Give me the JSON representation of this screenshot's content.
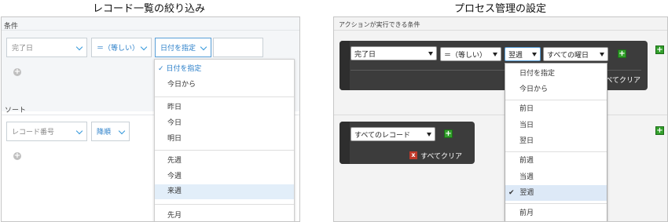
{
  "left": {
    "heading": "レコード一覧の絞り込み",
    "conditions_label": "条件",
    "field_select": "完了日",
    "operator_select": "＝（等しい）",
    "date_select": "日付を指定",
    "add_symbol": "+",
    "sort_label": "ソート",
    "sort_field_select": "レコード番号",
    "sort_order_select": "降順",
    "dropdown": {
      "groups": [
        [
          "日付を指定",
          "今日から"
        ],
        [
          "昨日",
          "今日",
          "明日"
        ],
        [
          "先週",
          "今週",
          "来週"
        ],
        [
          "先月"
        ]
      ],
      "checked": "日付を指定",
      "highlighted": "来週",
      "check_mark": "✓"
    }
  },
  "right": {
    "heading": "プロセス管理の設定",
    "conditions_label": "アクションが実行できる条件",
    "field_select": "完了日",
    "operator_select": "＝（等しい）",
    "period_select": "翌週",
    "weekday_select": "すべての曜日",
    "clear_label": "すべてクリア",
    "records_select": "すべてのレコード",
    "add_symbol": "+",
    "clear_symbol": "x",
    "dropdown": {
      "groups": [
        [
          "日付を指定",
          "今日から"
        ],
        [
          "前日",
          "当日",
          "翌日"
        ],
        [
          "前週",
          "当週",
          "翌週"
        ],
        [
          "前月"
        ]
      ],
      "checked": "翌週",
      "highlighted": "翌週",
      "check_mark": "✔"
    }
  }
}
